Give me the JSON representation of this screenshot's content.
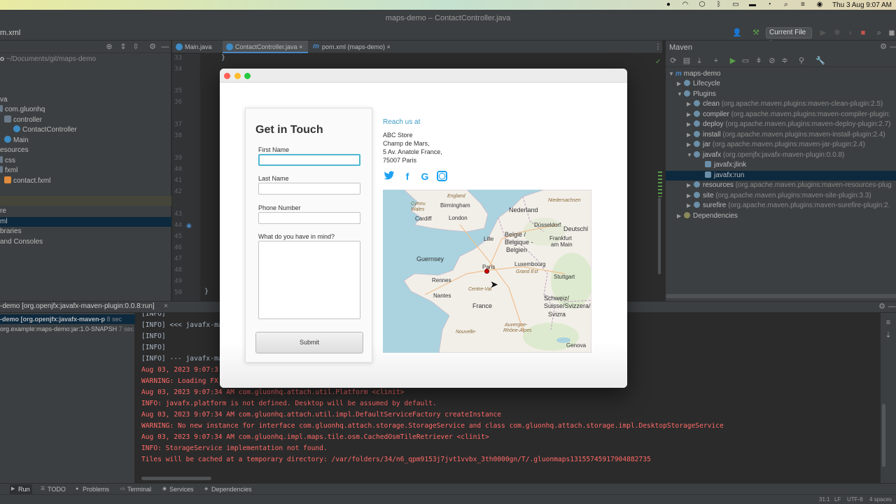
{
  "menubar": {
    "datetime": "Thu 3 Aug  9:07 AM"
  },
  "window": {
    "title": "maps-demo – ContactController.java"
  },
  "toolbar": {
    "breadcrumb": "m.xml",
    "run_config": "Current File"
  },
  "project": {
    "rows": [
      {
        "label": "o",
        "extra": "~/Documents/git/maps-demo"
      },
      {
        "label": "va"
      },
      {
        "label": "com.gluonhq"
      },
      {
        "label": "controller"
      },
      {
        "label": "ContactController"
      },
      {
        "label": "Main"
      },
      {
        "label": "esources"
      },
      {
        "label": "css"
      },
      {
        "label": "fxml"
      },
      {
        "label": "contact.fxml"
      },
      {
        "label": "re"
      },
      {
        "label": "ml"
      },
      {
        "label": "braries"
      },
      {
        "label": "and Consoles"
      }
    ]
  },
  "tabs": [
    {
      "label": "Main.java"
    },
    {
      "label": "ContactController.java"
    },
    {
      "label": "pom.xml (maps-demo)"
    }
  ],
  "line_numbers": [
    "33",
    "34",
    "35",
    "36",
    "37",
    "38",
    "39",
    "40",
    "41",
    "42",
    "43",
    "44",
    "45",
    "46",
    "47",
    "48",
    "49",
    "50"
  ],
  "editor": {
    "brace": "}",
    "brace2": "}"
  },
  "maven": {
    "title": "Maven",
    "rows": [
      {
        "label": "maps-demo",
        "extra": ""
      },
      {
        "label": "Lifecycle",
        "extra": ""
      },
      {
        "label": "Plugins",
        "extra": ""
      },
      {
        "label": "clean",
        "extra": "(org.apache.maven.plugins:maven-clean-plugin:2.5)"
      },
      {
        "label": "compiler",
        "extra": "(org.apache.maven.plugins:maven-compiler-plugin:"
      },
      {
        "label": "deploy",
        "extra": "(org.apache.maven.plugins:maven-deploy-plugin:2.7)"
      },
      {
        "label": "install",
        "extra": "(org.apache.maven.plugins:maven-install-plugin:2.4)"
      },
      {
        "label": "jar",
        "extra": "(org.apache.maven.plugins:maven-jar-plugin:2.4)"
      },
      {
        "label": "javafx",
        "extra": "(org.openjfx:javafx-maven-plugin:0.0.8)"
      },
      {
        "label": "javafx:jlink",
        "extra": ""
      },
      {
        "label": "javafx:run",
        "extra": ""
      },
      {
        "label": "resources",
        "extra": "(org.apache.maven.plugins:maven-resources-plug"
      },
      {
        "label": "site",
        "extra": "(org.apache.maven.plugins:maven-site-plugin:3.3)"
      },
      {
        "label": "surefire",
        "extra": "(org.apache.maven.plugins:maven-surefire-plugin:2."
      },
      {
        "label": "Dependencies",
        "extra": ""
      }
    ]
  },
  "run": {
    "title": "-demo [org.openjfx:javafx-maven-plugin:0.0.8:run]",
    "left_rows": [
      {
        "label": "-demo [org.openjfx:javafx-maven-p",
        "time": "8 sec"
      },
      {
        "label": "org.example:maps-demo:jar:1.0-SNAPSH",
        "time": "7 sec"
      }
    ],
    "console": [
      {
        "text": "[INFO]",
        "cls": "info"
      },
      {
        "text": "[INFO] <<< javafx-ma",
        "cls": "info"
      },
      {
        "text": "[INFO]",
        "cls": "info"
      },
      {
        "text": "[INFO]",
        "cls": "info"
      },
      {
        "text": "[INFO] --- javafx-ma",
        "cls": "info"
      },
      {
        "text": "Aug 03, 2023 9:07:3",
        "cls": "err"
      },
      {
        "text": "WARNING: Loading FX",
        "cls": "err"
      },
      {
        "text": "Aug 03, 2023 9:07:34 AM com.gluonhq.attach.util.Platform <clinit>",
        "cls": "err"
      },
      {
        "text": "INFO: javafx.platform is not defined. Desktop will be assumed by default.",
        "cls": "err"
      },
      {
        "text": "Aug 03, 2023 9:07:34 AM com.gluonhq.attach.util.impl.DefaultServiceFactory createInstance",
        "cls": "err"
      },
      {
        "text": "WARNING: No new instance for interface com.gluonhq.attach.storage.StorageService and class com.gluonhq.attach.storage.impl.DesktopStorageService",
        "cls": "err"
      },
      {
        "text": "Aug 03, 2023 9:07:34 AM com.gluonhq.impl.maps.tile.osm.CachedOsmTileRetriever <clinit>",
        "cls": "err"
      },
      {
        "text": "INFO: StorageService implementation not found.",
        "cls": "err"
      },
      {
        "text": "Tiles will be cached at a temporary directory: /var/folders/34/n6_qpm9153j7jvt1vvbx_3th0000gn/T/.gluonmaps13155745917904882735",
        "cls": "err"
      }
    ]
  },
  "bottom_tabs": [
    "Run",
    "TODO",
    "Problems",
    "Terminal",
    "Services",
    "Dependencies"
  ],
  "status": {
    "position": "31:1",
    "line_sep": "LF",
    "encoding": "UTF-8",
    "indent": "4 spaces"
  },
  "app": {
    "form": {
      "title": "Get in Touch",
      "first_name": "First Name",
      "last_name": "Last Name",
      "phone": "Phone Number",
      "message": "What do you have in mind?",
      "submit": "Submit"
    },
    "reach": "Reach us at",
    "address": [
      "ABC Store",
      "Champ de Mars,",
      "5 Av. Anatole France,",
      "75007 Paris"
    ],
    "social": [
      {
        "icon": "twitter-icon",
        "glyph": "🐦"
      },
      {
        "icon": "facebook-icon",
        "glyph": "f"
      },
      {
        "icon": "google-icon",
        "glyph": "G"
      },
      {
        "icon": "instagram-icon",
        "glyph": "◎"
      }
    ],
    "map_labels": {
      "birmingham": "Birmingham",
      "cardiff": "Cardiff",
      "london": "London",
      "nederland": "Nederland",
      "dusseldorf": "Düsseldorf",
      "deutschland": "Deutschl",
      "lille": "Lille",
      "belgie": "België /",
      "belgique": "Belgique -",
      "belgien": "Belgien",
      "frankfurt": "Frankfurt",
      "ammain": "am Main",
      "luxembourg": "Luxembourg",
      "paris": "Paris",
      "stuttgart": "Stuttgart",
      "guernsey": "Guernsey",
      "rennes": "Rennes",
      "nantes": "Nantes",
      "france": "France",
      "schweiz": "Schweiz/",
      "suisse": "Suisse/Svizzera/",
      "svizra": "Svizra",
      "geneva": "Genova",
      "grandest": "Grand Est",
      "centrevdl": "Centre-Val",
      "nouvelle": "Nouvelle-",
      "auvergne": "Auvergne-",
      "rhone": "Rhône-Alpes",
      "cymru": "Cymru",
      "england": "England",
      "wales": "Wales",
      "niedersachsen": "Niedersachsen"
    }
  },
  "colors": {
    "accent": "#4a88c7",
    "map_sea": "#aad3df",
    "map_land": "#f2efe9",
    "marker": "#cc0000"
  }
}
